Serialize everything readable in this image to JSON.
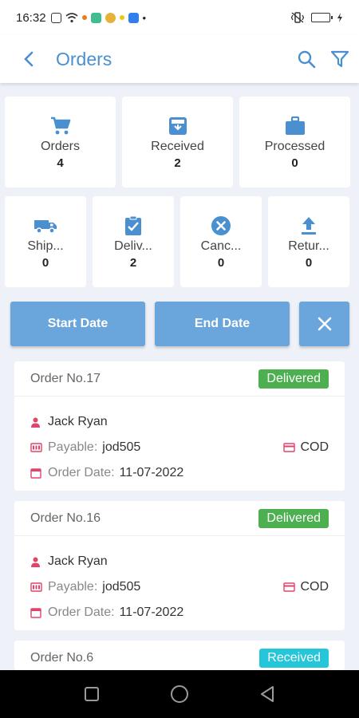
{
  "status_bar": {
    "time": "16:32"
  },
  "header": {
    "title": "Orders"
  },
  "stats_top": [
    {
      "label": "Orders",
      "count": "4",
      "icon": "cart-icon"
    },
    {
      "label": "Received",
      "count": "2",
      "icon": "inbox-icon"
    },
    {
      "label": "Processed",
      "count": "0",
      "icon": "briefcase-icon"
    }
  ],
  "stats_bottom": [
    {
      "label": "Ship...",
      "count": "0",
      "icon": "truck-icon"
    },
    {
      "label": "Deliv...",
      "count": "2",
      "icon": "clipboard-check-icon"
    },
    {
      "label": "Canc...",
      "count": "0",
      "icon": "cancel-icon"
    },
    {
      "label": "Retur...",
      "count": "0",
      "icon": "upload-icon"
    }
  ],
  "date_filter": {
    "start_label": "Start Date",
    "end_label": "End Date"
  },
  "orders": [
    {
      "order_no": "Order No.17",
      "status": "Delivered",
      "customer": "Jack Ryan",
      "payable_label": "Payable:",
      "payable_value": "jod505",
      "payment": "COD",
      "date_label": "Order Date:",
      "date_value": "11-07-2022"
    },
    {
      "order_no": "Order No.16",
      "status": "Delivered",
      "customer": "Jack Ryan",
      "payable_label": "Payable:",
      "payable_value": "jod505",
      "payment": "COD",
      "date_label": "Order Date:",
      "date_value": "11-07-2022"
    },
    {
      "order_no": "Order No.6",
      "status": "Received"
    }
  ],
  "colors": {
    "accent": "#4a8fd0",
    "delivered": "#4caf50",
    "received": "#26c6da",
    "icon_red": "#e0446a"
  }
}
